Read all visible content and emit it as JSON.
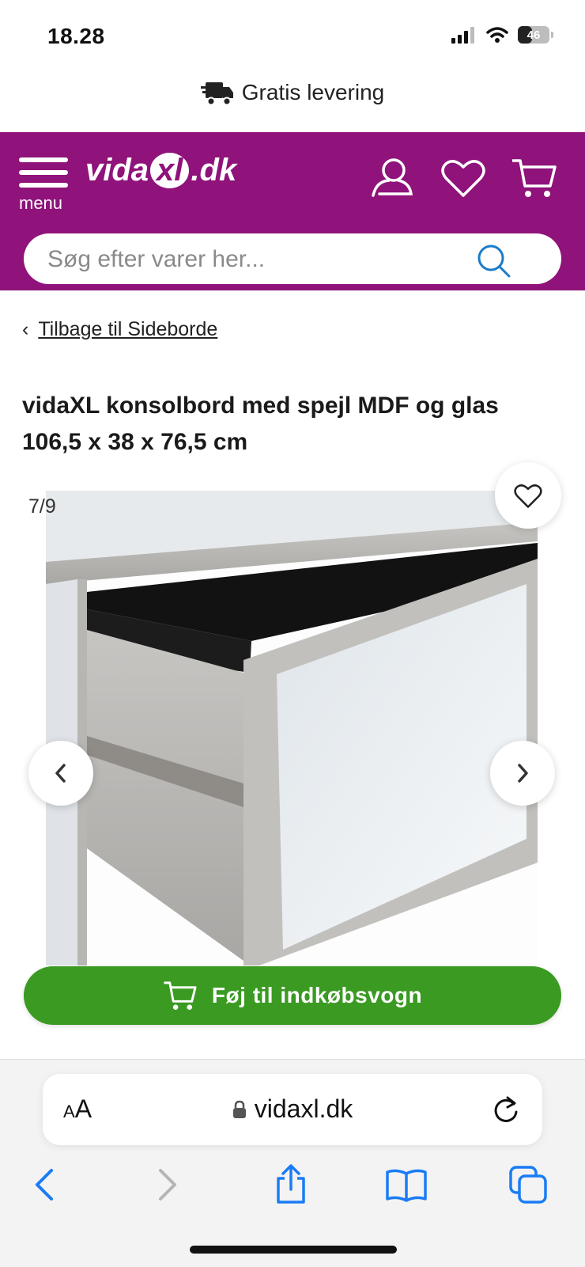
{
  "status": {
    "time": "18.28",
    "battery": "46",
    "battery_fraction": 0.46
  },
  "promo": {
    "text": "Gratis levering",
    "icon": "truck-icon"
  },
  "header": {
    "background": "#8f137a",
    "menu_label": "menu",
    "logo": {
      "prefix": "vida",
      "mark": "xl",
      "suffix": ".dk"
    },
    "icons": [
      "user-icon",
      "heart-icon",
      "cart-icon"
    ]
  },
  "search": {
    "placeholder": "Søg efter varer her...",
    "value": ""
  },
  "breadcrumb": {
    "chevron": "‹",
    "label": "Tilbage til Sideborde"
  },
  "product": {
    "title": "vidaXL konsolbord med spejl MDF og glas 106,5 x 38 x 76,5 cm",
    "gallery": {
      "counter": "7/9",
      "current": 7,
      "total": 9
    }
  },
  "actions": {
    "add_to_cart": "Føj til indkøbsvogn",
    "accent": "#3a9a22"
  },
  "browser": {
    "text_size_label_small": "A",
    "text_size_label_large": "A",
    "url": "vidaxl.dk",
    "toolbar": [
      "back-icon",
      "forward-icon",
      "share-icon",
      "bookmarks-icon",
      "tabs-icon"
    ],
    "tint": "#1a7cf5"
  }
}
